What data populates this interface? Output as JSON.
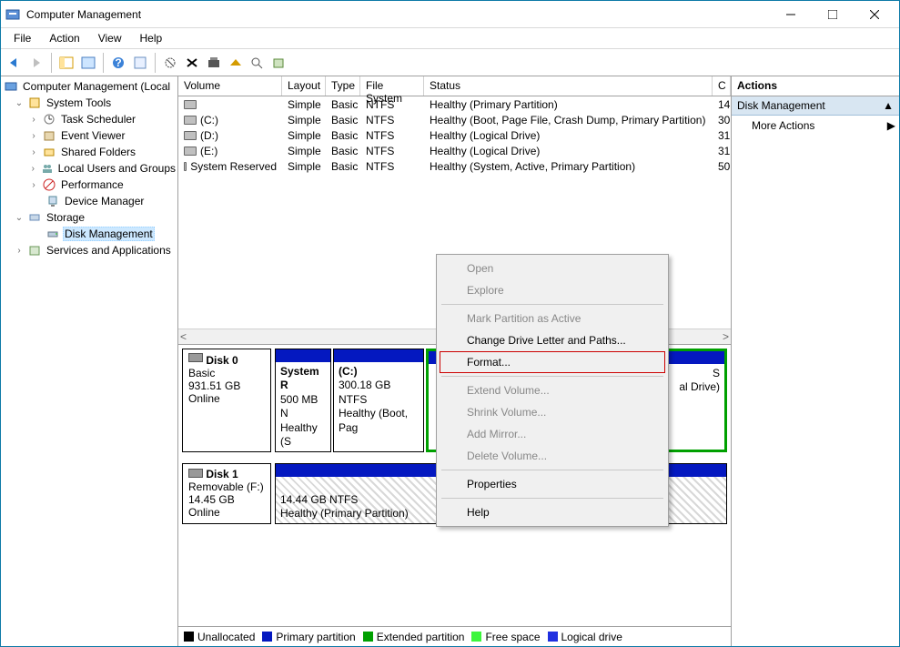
{
  "window": {
    "title": "Computer Management"
  },
  "menus": {
    "file": "File",
    "action": "Action",
    "view": "View",
    "help": "Help"
  },
  "tree": {
    "root": "Computer Management (Local",
    "systools": "System Tools",
    "tasksched": "Task Scheduler",
    "eventviewer": "Event Viewer",
    "sharedfolders": "Shared Folders",
    "localusers": "Local Users and Groups",
    "performance": "Performance",
    "devicemgr": "Device Manager",
    "storage": "Storage",
    "diskmgmt": "Disk Management",
    "services": "Services and Applications"
  },
  "vol_headers": {
    "volume": "Volume",
    "layout": "Layout",
    "type": "Type",
    "fs": "File System",
    "status": "Status",
    "cap": "C"
  },
  "vol_rows": [
    {
      "volume": "",
      "layout": "Simple",
      "type": "Basic",
      "fs": "NTFS",
      "status": "Healthy (Primary Partition)",
      "cap": "14"
    },
    {
      "volume": " (C:)",
      "layout": "Simple",
      "type": "Basic",
      "fs": "NTFS",
      "status": "Healthy (Boot, Page File, Crash Dump, Primary Partition)",
      "cap": "30"
    },
    {
      "volume": " (D:)",
      "layout": "Simple",
      "type": "Basic",
      "fs": "NTFS",
      "status": "Healthy (Logical Drive)",
      "cap": "31"
    },
    {
      "volume": " (E:)",
      "layout": "Simple",
      "type": "Basic",
      "fs": "NTFS",
      "status": "Healthy (Logical Drive)",
      "cap": "31"
    },
    {
      "volume": "System Reserved",
      "layout": "Simple",
      "type": "Basic",
      "fs": "NTFS",
      "status": "Healthy (System, Active, Primary Partition)",
      "cap": "50"
    }
  ],
  "disks": {
    "d0": {
      "name": "Disk 0",
      "type": "Basic",
      "size": "931.51 GB",
      "state": "Online"
    },
    "d1": {
      "name": "Disk 1",
      "type": "Removable (F:)",
      "size": "14.45 GB",
      "state": "Online"
    }
  },
  "parts": {
    "sr": {
      "title": "System R",
      "l2": "500 MB N",
      "l3": "Healthy (S"
    },
    "c": {
      "title": "(C:)",
      "l2": "300.18 GB NTFS",
      "l3": "Healthy (Boot, Pag"
    },
    "e": {
      "title": "",
      "l2": "S",
      "l3": "al Drive)"
    },
    "f": {
      "title": "",
      "l2": "14.44 GB NTFS",
      "l3": "Healthy (Primary Partition)"
    }
  },
  "legend": {
    "unalloc": "Unallocated",
    "primary": "Primary partition",
    "extended": "Extended partition",
    "free": "Free space",
    "logical": "Logical drive"
  },
  "actions": {
    "title": "Actions",
    "section": "Disk Management",
    "more": "More Actions"
  },
  "ctx": {
    "open": "Open",
    "explore": "Explore",
    "mark": "Mark Partition as Active",
    "change": "Change Drive Letter and Paths...",
    "format": "Format...",
    "extend": "Extend Volume...",
    "shrink": "Shrink Volume...",
    "mirror": "Add Mirror...",
    "delete": "Delete Volume...",
    "props": "Properties",
    "help": "Help"
  }
}
